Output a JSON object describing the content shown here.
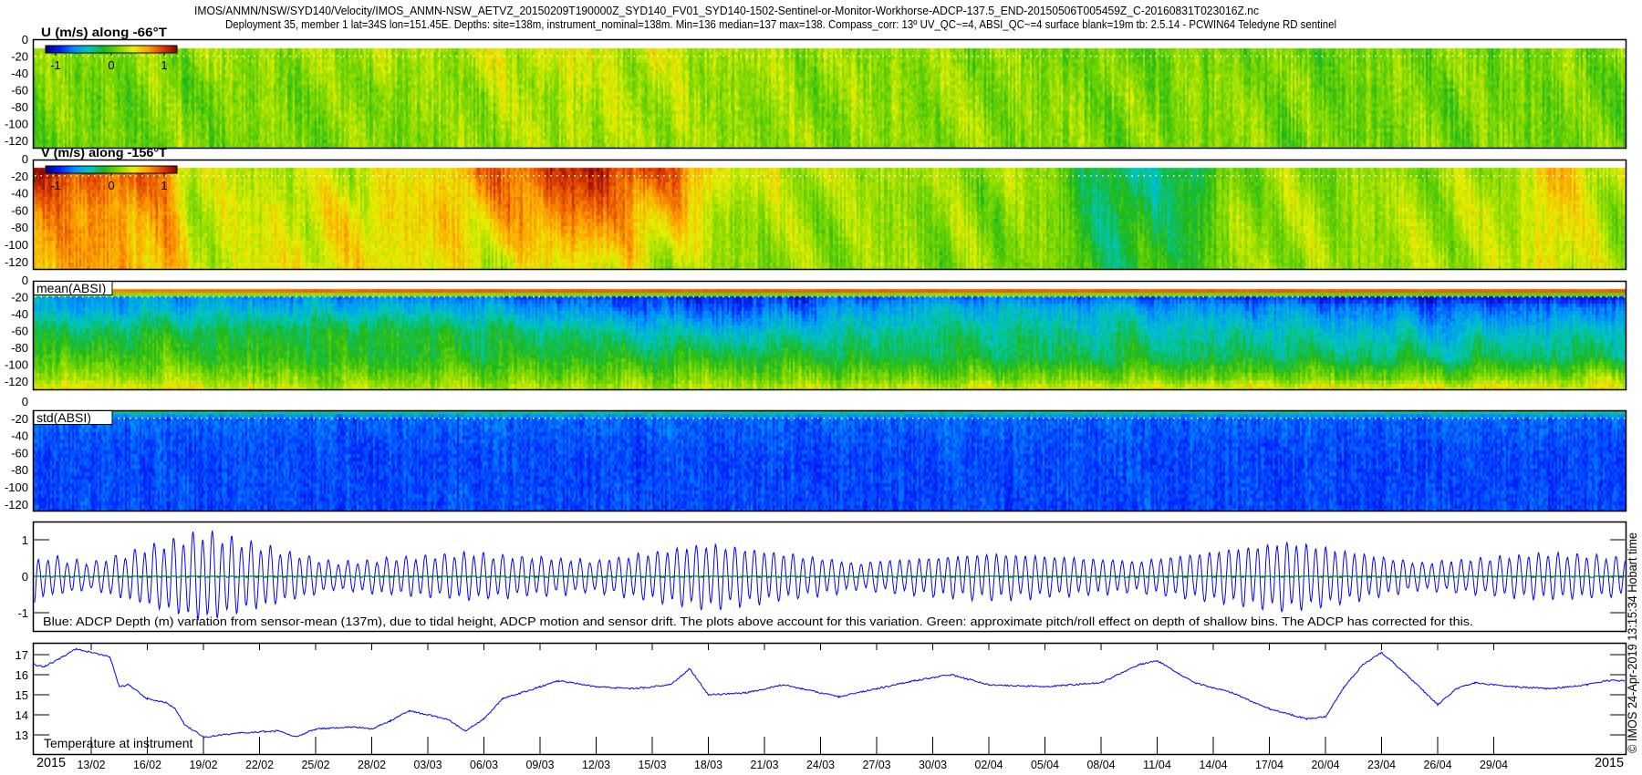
{
  "title": {
    "line1": "IMOS/ANMN/NSW/SYD140/Velocity/IMOS_ANMN-NSW_AETVZ_20150209T190000Z_SYD140_FV01_SYD140-1502-Sentinel-or-Monitor-Workhorse-ADCP-137.5_END-20150506T005459Z_C-20160831T023016Z.nc",
    "line2": "Deployment 35, member 1 lat=34S lon=151.45E. Depths: site=138m, instrument_nominal=138m. Min=136 median=137 max=138. Compass_corr: 13º UV_QC~=4, ABSI_QC~=4 surface blank=19m tb: 2.5.14 - PCWIN64 Teledyne RD sentinel"
  },
  "credit": "© IMOS 24-Apr-2019 13:15:34 Hobart time",
  "colors": {
    "axis": "#000000",
    "depth_line": "#0000ff",
    "pitchroll_line": "#008000",
    "temp_line": "#0000ff",
    "surface_line": "#ffffff"
  },
  "chart_data": [
    {
      "type": "heatmap",
      "id": "u",
      "label": "U (m/s) along -66°T",
      "x_unit": "days since 2015-02-09 00:00",
      "xlim": [
        0.85,
        86.05
      ],
      "ylim": [
        -129,
        0
      ],
      "y_ticks": [
        "0",
        "-20",
        "-40",
        "-60",
        "-80",
        "-100",
        "-120"
      ],
      "surface_blank_depth": -20,
      "data_top": -11,
      "clim": [
        -1.25,
        1.25
      ],
      "colorbar_ticks": [
        "-1",
        "0",
        "1"
      ],
      "colormap": [
        "#000080",
        "#0020ff",
        "#0090ff",
        "#00c8c0",
        "#1cb81c",
        "#7cd800",
        "#e8f000",
        "#ffa000",
        "#e04000",
        "#800000"
      ],
      "depth_levels": [
        -12,
        -60,
        -128
      ],
      "profile": [
        {
          "day": 1,
          "values": [
            0.15,
            0.1,
            0.1
          ]
        },
        {
          "day": 20,
          "values": [
            0.25,
            0.15,
            0.15
          ]
        },
        {
          "day": 30,
          "values": [
            0.35,
            0.3,
            0.25
          ]
        },
        {
          "day": 40,
          "values": [
            0.25,
            0.2,
            0.2
          ]
        },
        {
          "day": 60,
          "values": [
            0.1,
            0.15,
            0.15
          ]
        },
        {
          "day": 86,
          "values": [
            0.15,
            0.1,
            0.1
          ]
        }
      ]
    },
    {
      "type": "heatmap",
      "id": "v",
      "label": "V (m/s) along -156°T",
      "xlim": [
        0.85,
        86.05
      ],
      "ylim": [
        -130,
        0
      ],
      "y_ticks": [
        "0",
        "-20",
        "-40",
        "-60",
        "-80",
        "-100",
        "-120"
      ],
      "surface_blank_depth": -20,
      "data_top": -11,
      "clim": [
        -1.25,
        1.25
      ],
      "colorbar_ticks": [
        "-1",
        "0",
        "1"
      ],
      "depth_levels": [
        -12,
        -60,
        -128
      ],
      "profile": [
        {
          "day": 1,
          "values": [
            1.05,
            0.75,
            0.7
          ]
        },
        {
          "day": 8,
          "values": [
            0.8,
            0.65,
            0.6
          ]
        },
        {
          "day": 9.5,
          "values": [
            0.3,
            0.3,
            0.3
          ]
        },
        {
          "day": 16,
          "values": [
            0.3,
            0.4,
            0.45
          ]
        },
        {
          "day": 22,
          "values": [
            0.45,
            0.5,
            0.45
          ]
        },
        {
          "day": 25,
          "values": [
            0.8,
            0.6,
            0.35
          ]
        },
        {
          "day": 30,
          "values": [
            1.1,
            0.85,
            0.45
          ]
        },
        {
          "day": 35,
          "values": [
            0.9,
            0.6,
            0.3
          ]
        },
        {
          "day": 38,
          "values": [
            0.35,
            0.25,
            0.15
          ]
        },
        {
          "day": 45,
          "values": [
            0.25,
            0.2,
            0.2
          ]
        },
        {
          "day": 55,
          "values": [
            0.2,
            0.15,
            0.15
          ]
        },
        {
          "day": 58,
          "values": [
            -0.3,
            -0.25,
            -0.15
          ]
        },
        {
          "day": 63,
          "values": [
            -0.25,
            -0.15,
            -0.05
          ]
        },
        {
          "day": 65,
          "values": [
            0.15,
            0.2,
            0.2
          ]
        },
        {
          "day": 80,
          "values": [
            0.2,
            0.25,
            0.25
          ]
        },
        {
          "day": 82,
          "values": [
            0.6,
            0.5,
            0.45
          ]
        },
        {
          "day": 86,
          "values": [
            0.3,
            0.2,
            0.2
          ]
        }
      ]
    },
    {
      "type": "heatmap",
      "id": "mean_absi",
      "label": "mean(ABSI)",
      "xlim": [
        0.85,
        86.05
      ],
      "ylim": [
        -129,
        0
      ],
      "y_ticks": [
        "0",
        "-20",
        "-40",
        "-60",
        "-80",
        "-100",
        "-120"
      ],
      "surface_blank_depth": -20,
      "data_top": -11,
      "clim": [
        0,
        1
      ],
      "depth_levels": [
        -13,
        -18,
        -30,
        -60,
        -90,
        -115,
        -128
      ],
      "profile": [
        {
          "day": 1,
          "values": [
            0.8,
            0.25,
            0.25,
            0.4,
            0.5,
            0.6,
            0.7
          ]
        },
        {
          "day": 20,
          "values": [
            0.85,
            0.22,
            0.3,
            0.45,
            0.45,
            0.55,
            0.62
          ]
        },
        {
          "day": 38,
          "values": [
            0.85,
            0.1,
            0.15,
            0.3,
            0.45,
            0.55,
            0.62
          ]
        },
        {
          "day": 50,
          "values": [
            0.85,
            0.2,
            0.3,
            0.38,
            0.42,
            0.55,
            0.66
          ]
        },
        {
          "day": 78,
          "values": [
            0.85,
            0.07,
            0.18,
            0.3,
            0.4,
            0.55,
            0.7
          ]
        },
        {
          "day": 86,
          "values": [
            0.85,
            0.1,
            0.2,
            0.35,
            0.4,
            0.6,
            0.66
          ]
        }
      ]
    },
    {
      "type": "heatmap",
      "id": "std_absi",
      "label": "std(ABSI)",
      "xlim": [
        0.85,
        86.05
      ],
      "ylim": [
        -129,
        0
      ],
      "y_ticks": [
        "0",
        "-20",
        "-40",
        "-60",
        "-80",
        "-100",
        "-120"
      ],
      "surface_blank_depth": -20,
      "data_top": -10,
      "clim": [
        0,
        1
      ],
      "depth_levels": [
        -10,
        -17,
        -60,
        -128
      ],
      "profile": [
        {
          "day": 1,
          "values": [
            0.38,
            0.18,
            0.15,
            0.15
          ]
        },
        {
          "day": 86,
          "values": [
            0.38,
            0.18,
            0.15,
            0.15
          ]
        }
      ]
    },
    {
      "type": "line",
      "id": "depth",
      "xlim": [
        0.85,
        86.05
      ],
      "ylim": [
        -1.5,
        1.5
      ],
      "y_ticks": [
        1,
        0,
        -1
      ],
      "y_tick_labels": [
        "1",
        "0",
        "-1"
      ],
      "annotation": "Blue: ADCP Depth (m) variation from sensor-mean (137m), due to tidal height, ADCP motion and sensor drift. The plots above account for this variation. Green: approximate pitch/roll effect on depth of shallow bins. The ADCP has corrected for this.",
      "series": [
        {
          "name": "ADCP depth variation (m)",
          "color": "#0000ff",
          "tidal_cycles_per_day": 1.932,
          "amplitude_envelope": [
            [
              1,
              0.55
            ],
            [
              4,
              0.35
            ],
            [
              10,
              1.15
            ],
            [
              17,
              0.35
            ],
            [
              24,
              0.6
            ],
            [
              31,
              0.4
            ],
            [
              37,
              0.85
            ],
            [
              45,
              0.35
            ],
            [
              52,
              0.6
            ],
            [
              60,
              0.4
            ],
            [
              68,
              0.9
            ],
            [
              75,
              0.35
            ],
            [
              82,
              0.6
            ],
            [
              86,
              0.5
            ]
          ]
        },
        {
          "name": "pitch/roll effect (m)",
          "color": "#008000",
          "level": 0
        }
      ]
    },
    {
      "type": "line",
      "id": "temperature",
      "label": "Temperature at instrument",
      "xlim": [
        0.85,
        86.05
      ],
      "ylim": [
        12.05,
        17.6
      ],
      "y_ticks": [
        17,
        16,
        15,
        14,
        13
      ],
      "y_tick_labels": [
        "17",
        "16",
        "15",
        "14",
        "13"
      ],
      "x": [
        0.9,
        1.5,
        2.5,
        3.2,
        4,
        5,
        5.5,
        6,
        7,
        8,
        8.5,
        9,
        10,
        12,
        14,
        15,
        16,
        18,
        19,
        20,
        21,
        22,
        23,
        24,
        25,
        26,
        28,
        29,
        31,
        33,
        35,
        36,
        37,
        39,
        41,
        42,
        44,
        46,
        48,
        50,
        52,
        55,
        58,
        60,
        61,
        63,
        65,
        67,
        69,
        70,
        71,
        72,
        73,
        74,
        76,
        77,
        78,
        80,
        82,
        84,
        85,
        86
      ],
      "y": [
        16.5,
        16.4,
        16.9,
        17.3,
        17.1,
        16.9,
        15.4,
        15.5,
        14.8,
        14.6,
        14.3,
        13.5,
        12.9,
        13.1,
        13.2,
        12.9,
        13.3,
        13.4,
        13.3,
        13.7,
        14.2,
        14.0,
        13.8,
        13.2,
        13.8,
        14.8,
        15.4,
        15.7,
        15.4,
        15.3,
        15.5,
        16.3,
        15.0,
        15.1,
        15.5,
        15.3,
        14.9,
        15.3,
        15.7,
        16.0,
        15.5,
        15.4,
        15.6,
        16.5,
        16.7,
        15.6,
        15.1,
        14.3,
        13.8,
        13.9,
        15.4,
        16.5,
        17.1,
        16.3,
        14.5,
        15.3,
        15.6,
        15.4,
        15.3,
        15.5,
        15.7,
        15.7
      ]
    }
  ],
  "x_axis": {
    "start_label": "2015",
    "end_label": "2015",
    "tick_days": [
      4,
      7,
      10,
      13,
      16,
      19,
      22,
      25,
      28,
      31,
      34,
      37,
      40,
      43,
      46,
      49,
      52,
      55,
      58,
      61,
      64,
      67,
      70,
      73,
      76,
      79
    ],
    "tick_labels": [
      "13/02",
      "16/02",
      "19/02",
      "22/02",
      "25/02",
      "28/02",
      "03/03",
      "06/03",
      "09/03",
      "12/03",
      "15/03",
      "18/03",
      "21/03",
      "24/03",
      "27/03",
      "30/03",
      "02/04",
      "05/04",
      "08/04",
      "11/04",
      "14/04",
      "17/04",
      "20/04",
      "23/04",
      "26/04",
      "29/04"
    ]
  }
}
